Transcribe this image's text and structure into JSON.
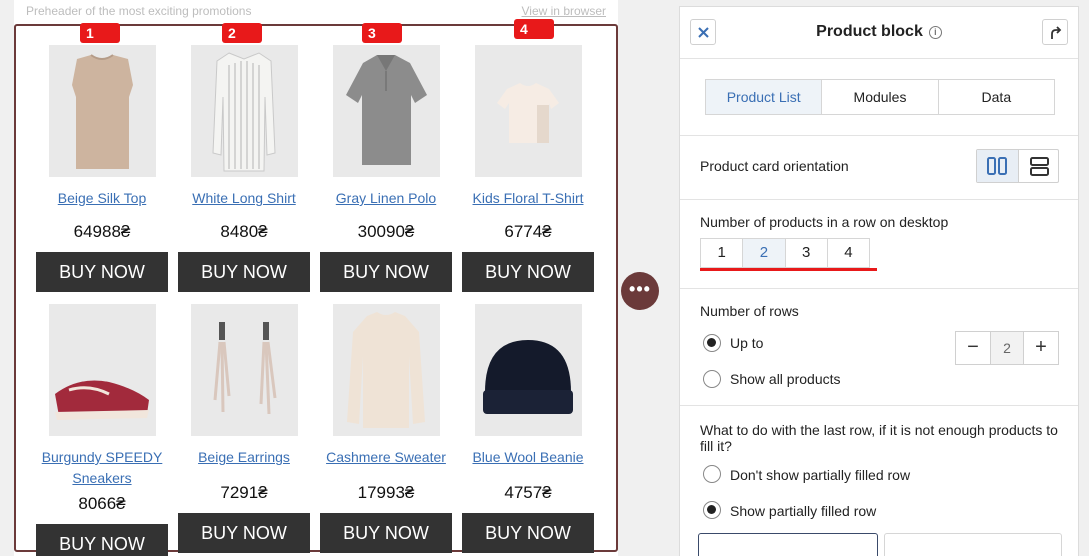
{
  "email": {
    "preheader": "Preheader of the most exciting promotions",
    "view_in_browser": "View in browser",
    "badges": [
      "1",
      "2",
      "3",
      "4"
    ],
    "products": [
      {
        "name": "Beige Silk Top",
        "price": "64988₴",
        "buy": "BUY NOW"
      },
      {
        "name": "White Long Shirt",
        "price": "8480₴",
        "buy": "BUY NOW"
      },
      {
        "name": "Gray Linen Polo",
        "price": "30090₴",
        "buy": "BUY NOW"
      },
      {
        "name": "Kids Floral T-Shirt",
        "price": "6774₴",
        "buy": "BUY NOW"
      },
      {
        "name": "Burgundy SPEEDY Sneakers",
        "price": "8066₴",
        "buy": "BUY NOW"
      },
      {
        "name": "Beige Earrings",
        "price": "7291₴",
        "buy": "BUY NOW"
      },
      {
        "name": "Cashmere Sweater",
        "price": "17993₴",
        "buy": "BUY NOW"
      },
      {
        "name": "Blue Wool Beanie",
        "price": "4757₴",
        "buy": "BUY NOW"
      }
    ],
    "more_button": "•••"
  },
  "panel": {
    "title": "Product block",
    "info_icon": "i",
    "tabs": [
      "Product List",
      "Modules",
      "Data"
    ],
    "active_tab": "Product List",
    "orientation_label": "Product card orientation",
    "orientation_selected": "vertical",
    "per_row_label": "Number of products in a row on desktop",
    "per_row_options": [
      "1",
      "2",
      "3",
      "4"
    ],
    "per_row_selected": "2",
    "rows_label": "Number of rows",
    "rows_option_up_to": "Up to",
    "rows_option_all": "Show all products",
    "rows_selected": "Up to",
    "stepper_minus": "−",
    "stepper_value": "2",
    "stepper_plus": "+",
    "last_row_question": "What to do with the last row, if it is not enough products to fill it?",
    "last_row_option_hide": "Don't show partially filled row",
    "last_row_option_show": "Show partially filled row",
    "last_row_selected": "Show partially filled row"
  },
  "colors": {
    "accent_red": "#e8191a",
    "block_border": "#6b3a3a",
    "link_blue": "#3a6fb4",
    "buy_button": "#333333"
  }
}
